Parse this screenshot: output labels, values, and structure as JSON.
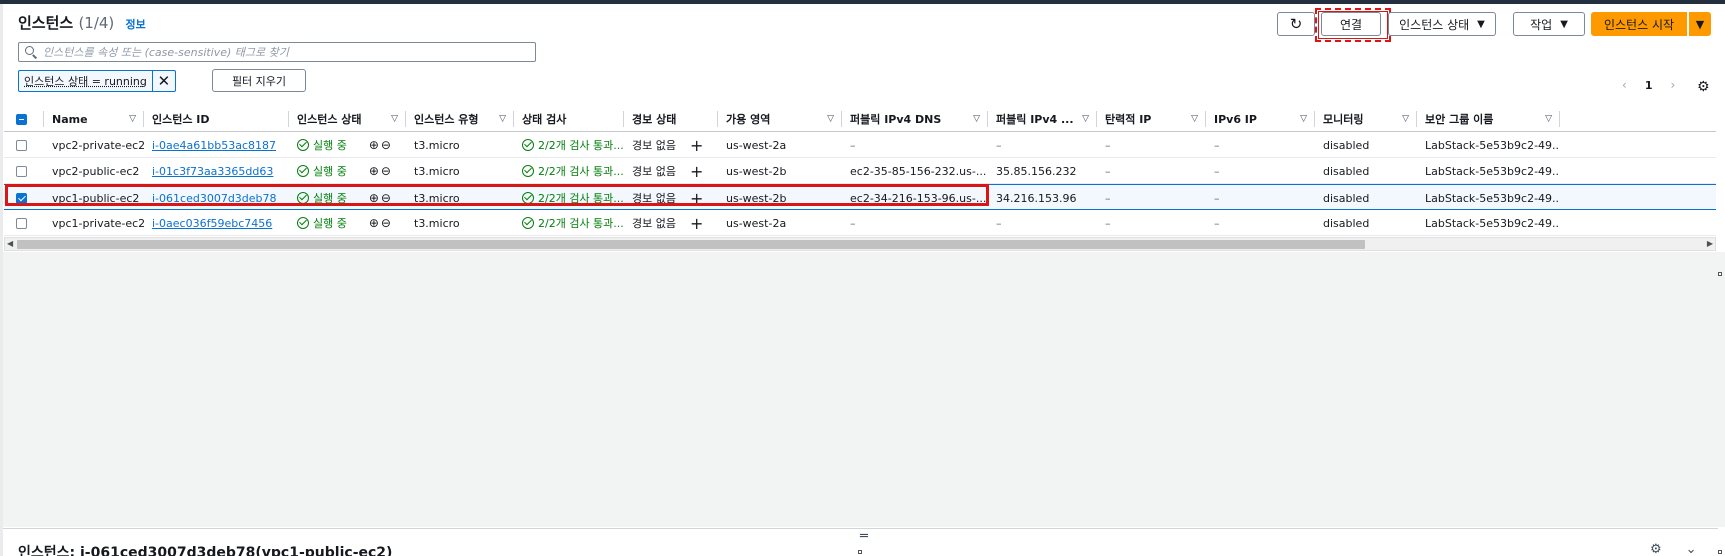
{
  "header": {
    "title": "인스턴스",
    "count": "(1/4)",
    "info_link": "정보"
  },
  "toolbar": {
    "refresh_icon": "refresh-icon",
    "connect_label": "연결",
    "instance_state_label": "인스턴스 상태",
    "actions_label": "작업",
    "launch_label": "인스턴스 시작"
  },
  "search": {
    "placeholder": "인스턴스를 속성 또는 (case-sensitive) 태그로 찾기"
  },
  "filter": {
    "token_label": "인스턴스 상태 = running",
    "clear_label": "필터 지우기"
  },
  "pagination": {
    "current_page": "1"
  },
  "columns": [
    "Name",
    "인스턴스 ID",
    "인스턴스 상태",
    "인스턴스 유형",
    "상태 검사",
    "경보 상태",
    "가용 영역",
    "퍼블릭 IPv4 DNS",
    "퍼블릭 IPv4 ...",
    "탄력적 IP",
    "IPv6 IP",
    "모니터링",
    "보안 그룹 이름"
  ],
  "rows": [
    {
      "selected": false,
      "name": "vpc2-private-ec2",
      "id": "i-0ae4a61bb53ac8187",
      "state": "실행 중",
      "type": "t3.micro",
      "check": "2/2개 검사 통과...",
      "alarm": "경보 없음",
      "az": "us-west-2a",
      "dns": "–",
      "ipv4": "–",
      "eip": "–",
      "ipv6": "–",
      "monitoring": "disabled",
      "sg": "LabStack-5e53b9c2-49..."
    },
    {
      "selected": false,
      "name": "vpc2-public-ec2",
      "id": "i-01c3f73aa3365dd63",
      "state": "실행 중",
      "type": "t3.micro",
      "check": "2/2개 검사 통과...",
      "alarm": "경보 없음",
      "az": "us-west-2b",
      "dns": "ec2-35-85-156-232.us-...",
      "ipv4": "35.85.156.232",
      "eip": "–",
      "ipv6": "–",
      "monitoring": "disabled",
      "sg": "LabStack-5e53b9c2-49..."
    },
    {
      "selected": true,
      "name": "vpc1-public-ec2",
      "id": "i-061ced3007d3deb78",
      "state": "실행 중",
      "type": "t3.micro",
      "check": "2/2개 검사 통과...",
      "alarm": "경보 없음",
      "az": "us-west-2b",
      "dns": "ec2-34-216-153-96.us-...",
      "ipv4": "34.216.153.96",
      "eip": "–",
      "ipv6": "–",
      "monitoring": "disabled",
      "sg": "LabStack-5e53b9c2-49..."
    },
    {
      "selected": false,
      "name": "vpc1-private-ec2",
      "id": "i-0aec036f59ebc7456",
      "state": "실행 중",
      "type": "t3.micro",
      "check": "2/2개 검사 통과...",
      "alarm": "경보 없음",
      "az": "us-west-2a",
      "dns": "–",
      "ipv4": "–",
      "eip": "–",
      "ipv6": "–",
      "monitoring": "disabled",
      "sg": "LabStack-5e53b9c2-49..."
    }
  ],
  "detail_panel": {
    "title": "인스턴스: i-061ced3007d3deb78(vpc1-public-ec2)"
  },
  "colors": {
    "accent": "#0972d3",
    "success": "#037f0c",
    "primary_button": "#ff9900",
    "annotation": "#d91515"
  }
}
